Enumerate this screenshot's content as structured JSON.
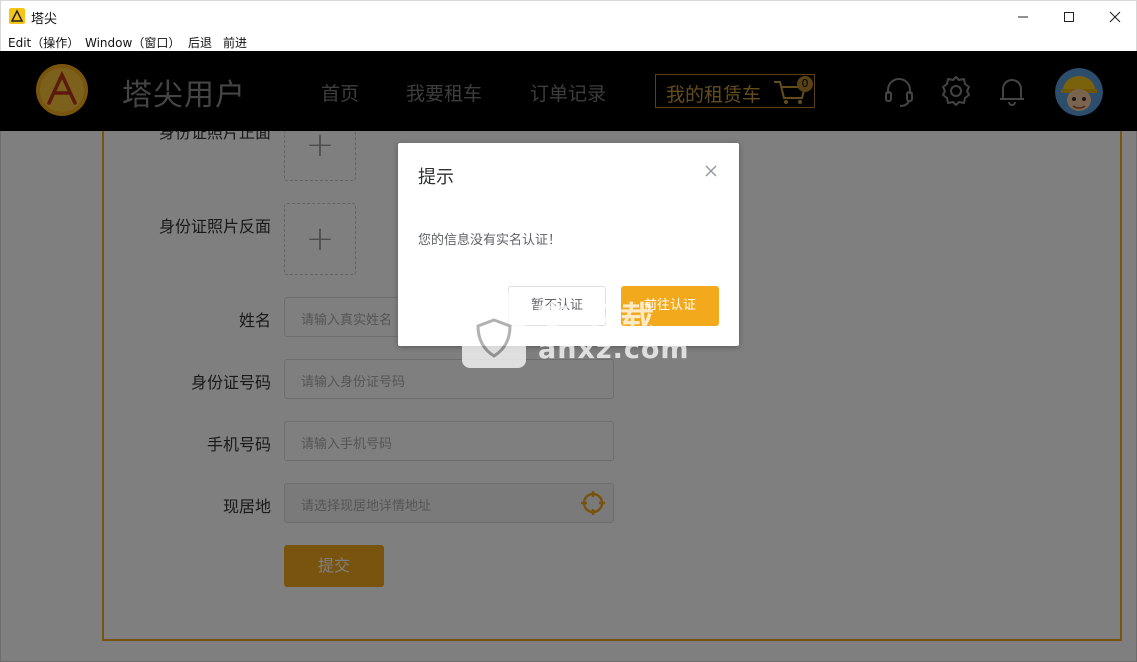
{
  "window": {
    "title": "塔尖",
    "minimize": "—",
    "maximize": "☐",
    "close": "✕"
  },
  "menubar": {
    "items": [
      "Edit（操作）",
      "Window（窗口）",
      "后退",
      "前进"
    ]
  },
  "header": {
    "brand": "塔尖用户",
    "nav": [
      "首页",
      "我要租车",
      "订单记录"
    ],
    "rent_button": "我的租赁车",
    "cart_count": "0",
    "accent": "#f3a91c"
  },
  "form": {
    "id_front_label": "身份证照片正面",
    "id_back_label": "身份证照片反面",
    "name_label": "姓名",
    "name_placeholder": "请输入真实姓名",
    "id_number_label": "身份证号码",
    "id_number_placeholder": "请输入身份证号码",
    "phone_label": "手机号码",
    "phone_placeholder": "请输入手机号码",
    "address_label": "现居地",
    "address_placeholder": "请选择现居地详情地址",
    "submit": "提交"
  },
  "dialog": {
    "title": "提示",
    "message": "您的信息没有实名认证！",
    "cancel": "暂不认证",
    "confirm": "前往认证"
  },
  "watermark": {
    "line1": "安下载",
    "line2": "anxz.com"
  }
}
